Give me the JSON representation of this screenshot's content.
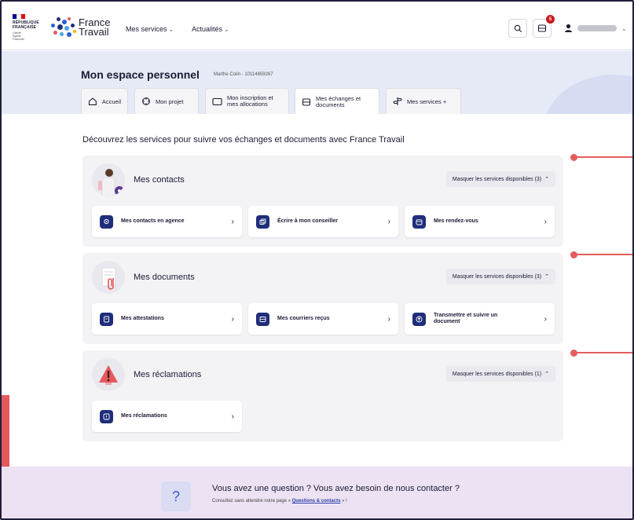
{
  "header": {
    "rf_logo": [
      "RÉPUBLIQUE",
      "FRANÇAISE"
    ],
    "rf_motto": [
      "Liberté",
      "Égalité",
      "Fraternité"
    ],
    "brand": [
      "France",
      "Travail"
    ],
    "nav": [
      {
        "label": "Mes services"
      },
      {
        "label": "Actualités"
      }
    ],
    "notification_count": "5"
  },
  "espace": {
    "title": "Mon espace personnel",
    "subtitle": "Marthe Colin - 10114859267",
    "tabs": [
      {
        "label": "Accueil"
      },
      {
        "label": "Mon projet"
      },
      {
        "label": "Mon inscription et",
        "label2": "mes allocations"
      },
      {
        "label": "Mes échanges et",
        "label2": "documents"
      },
      {
        "label": "Mes services +"
      }
    ]
  },
  "intro": "Découvrez les services pour suivre vos échanges et documents avec France Travail",
  "cards": [
    {
      "title": "Mes contacts",
      "toggle": "Masquer les services disponibles (3)",
      "services": [
        {
          "label": "Mes contacts en agence"
        },
        {
          "label": "Écrire à mon conseiller"
        },
        {
          "label": "Mes rendez-vous"
        }
      ]
    },
    {
      "title": "Mes documents",
      "toggle": "Masquer les services disponibles (3)",
      "services": [
        {
          "label": "Mes attestations"
        },
        {
          "label": "Mes courriers reçus"
        },
        {
          "label": "Transmettre et suivre un",
          "label2": "document"
        }
      ]
    },
    {
      "title": "Mes réclamations",
      "toggle": "Masquer les services disponibles (1)",
      "services": [
        {
          "label": "Mes réclamations"
        }
      ]
    }
  ],
  "footer": {
    "title": "Vous avez une question ? Vous avez besoin de nous contacter ?",
    "sub_before": "Consultez sans attendre notre page «",
    "link": "Questions & contacts",
    "sub_after": "» !",
    "icon": "?"
  },
  "colors": {
    "accent_red": "#e35d5d",
    "brand_navy": "#1f2d7a",
    "band_bg": "#e6eaf7",
    "footer_bg": "#ece2f3"
  }
}
